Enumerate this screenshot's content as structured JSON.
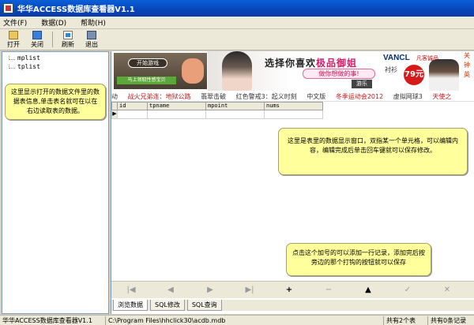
{
  "window": {
    "title": "华华ACCESS数据库查看器V1.1"
  },
  "menu": [
    "文件(F)",
    "数据(D)",
    "帮助(H)"
  ],
  "toolbar": {
    "open_label": "打开",
    "close_label": "关闭",
    "refresh_label": "刷新",
    "exit_label": "退出"
  },
  "tree": {
    "items": [
      "mplist",
      "tplist"
    ]
  },
  "callouts": {
    "left": "这里显示打开的数据文件里的数据表信息,单击表名就可在以在右边读取表的数据。",
    "right": "这里是表里的数据显示窗口，双指某一个单元格，可以编辑内容，编辑完成后单击回车键就可以保存修改。",
    "bottom": "点击这个加号的可以添加一行记录，添加完后按旁边的那个打钩的按钮就可以保存"
  },
  "ads": {
    "game_button": "开始游戏",
    "game_sub": "马上领取性感宝贝",
    "slogan_pre": "选择你喜欢",
    "slogan_hl": "极品御姐",
    "bubble": "做你想做的事!",
    "play_btn": "游乐",
    "brand": "VANCL",
    "brand_tag": "凡客诚品",
    "shirt": "衬衫",
    "price": "79元",
    "edge": [
      "关",
      "钟",
      "英"
    ]
  },
  "news": [
    "动",
    "战火兄弟连：地狱公路",
    "翡翠击破",
    "红色警戒3：起义时刻",
    "中文版",
    "冬季运动会2012",
    "虚拟网球3",
    "天使之"
  ],
  "grid": {
    "columns": [
      "id",
      "tpname",
      "mpoint",
      "nums"
    ],
    "indicator": "▶"
  },
  "navigator": [
    "|◀",
    "◀",
    "▶",
    "▶|",
    "+",
    "−",
    "▲",
    "✓",
    "✕"
  ],
  "tabs": [
    "浏览数据",
    "SQL修改",
    "SQL查询"
  ],
  "status": {
    "app": "华华ACCESS数据库查看器V1.1",
    "path": "C:\\Program Files\\hhclick30\\acdb.mdb",
    "tables": "共有2个表",
    "records": "共有0条记录"
  }
}
